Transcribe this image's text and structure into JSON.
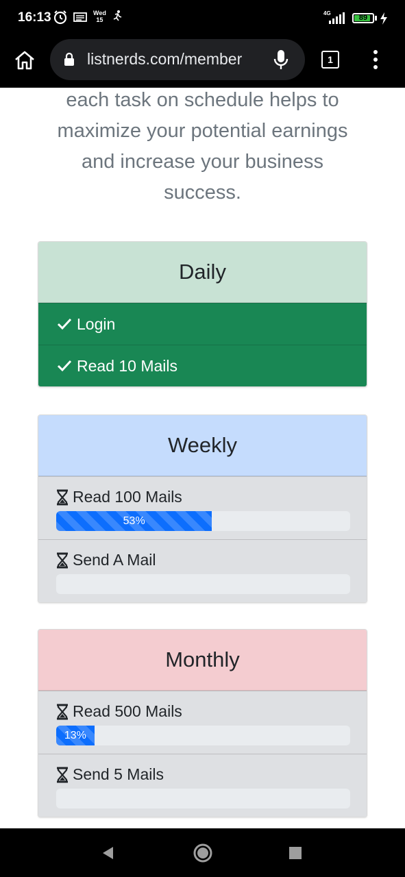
{
  "status_bar": {
    "time": "16:13",
    "date_day": "Wed",
    "date_num": "15",
    "network": "4G",
    "battery": "89",
    "battery_level": 0.89
  },
  "browser": {
    "url": "listnerds.com/member",
    "tab_count": "1"
  },
  "intro_text": "each task on schedule helps to maximize your potential earnings and increase your business success.",
  "daily": {
    "title": "Daily",
    "color": "#c8e2d4",
    "items": [
      {
        "label": "Login"
      },
      {
        "label": "Read 10 Mails"
      }
    ]
  },
  "weekly": {
    "title": "Weekly",
    "color": "#c5dcfd",
    "items": [
      {
        "label": "Read 100 Mails",
        "progress": 53,
        "progress_text": "53%"
      },
      {
        "label": "Send A Mail",
        "progress": 0,
        "progress_text": ""
      }
    ]
  },
  "monthly": {
    "title": "Monthly",
    "color": "#f4ccd0",
    "items": [
      {
        "label": "Read 500 Mails",
        "progress": 13,
        "progress_text": "13%"
      },
      {
        "label": "Send 5 Mails",
        "progress": 0,
        "progress_text": ""
      }
    ]
  },
  "colors": {
    "success": "#198754",
    "primary": "#0d6efd",
    "task_bg": "#dee0e3"
  },
  "icons": [
    "alarm-icon",
    "cast-icon",
    "activity-icon",
    "signal-icon",
    "battery-icon",
    "charging-icon",
    "home-icon",
    "lock-icon",
    "mic-icon",
    "tabs-icon",
    "more-icon",
    "check-icon",
    "hourglass-icon",
    "back-icon",
    "home-circle-icon",
    "recents-icon"
  ]
}
